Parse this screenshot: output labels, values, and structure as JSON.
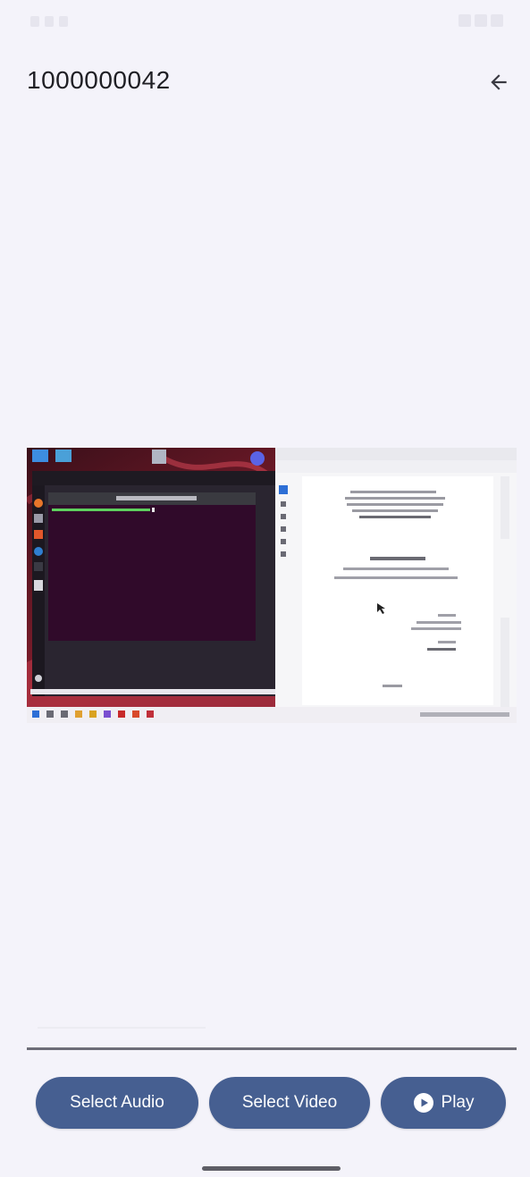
{
  "app_bar": {
    "title": "1000000042",
    "back_icon": "arrow-left-icon"
  },
  "video": {
    "thumbnail": "desktop-screen-recording",
    "progress": 0.36
  },
  "buttons": {
    "select_audio": "Select Audio",
    "select_video": "Select Video",
    "play": "Play",
    "play_icon": "play-circle-icon"
  },
  "colors": {
    "background": "#f4f3fa",
    "button": "#465f91",
    "button_text": "#ffffff",
    "title_text": "#1f1f24"
  }
}
